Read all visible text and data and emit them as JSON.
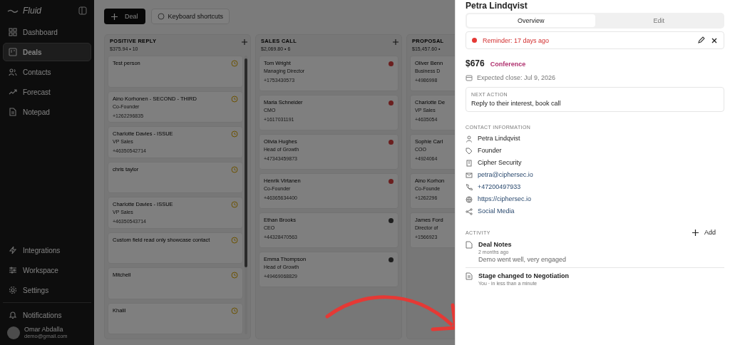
{
  "sidebar": {
    "logo": "Fluid",
    "nav": [
      {
        "label": "Dashboard",
        "selected": false
      },
      {
        "label": "Deals",
        "selected": true
      },
      {
        "label": "Contacts",
        "selected": false
      },
      {
        "label": "Forecast",
        "selected": false
      },
      {
        "label": "Notepad",
        "selected": false
      }
    ],
    "bottom_nav": [
      {
        "label": "Integrations"
      },
      {
        "label": "Workspace"
      },
      {
        "label": "Settings"
      }
    ],
    "notifications": "Notifications",
    "user": {
      "name": "Omar Abdalla",
      "email": "demo@gmail.com"
    }
  },
  "toolbar": {
    "new_button": "Deal",
    "shortcuts_button": "Keyboard shortcuts"
  },
  "columns": [
    {
      "title": "POSITIVE REPLY",
      "summary": "$375.94 • 10",
      "add": true,
      "scrollable": true,
      "cards": [
        {
          "kind": "task",
          "name": "Test person"
        },
        {
          "kind": "task",
          "name": "Aino Korhonen - SECOND - THIRD",
          "role": "Co-Founder",
          "phone": "+1262296835"
        },
        {
          "kind": "task",
          "name": "Charlotte Davies - ISSUE",
          "role": "VP Sales",
          "phone": "+46350542714"
        },
        {
          "kind": "task",
          "name": "chris taylor"
        },
        {
          "kind": "task",
          "name": "Charlotte Davies - ISSUE",
          "role": "VP Sales",
          "phone": "+46350543714"
        },
        {
          "kind": "task",
          "name": "Custom field read only showcase contact"
        },
        {
          "kind": "task",
          "name": "Mitchell"
        },
        {
          "kind": "task",
          "name": "Khalil"
        }
      ]
    },
    {
      "title": "SALES CALL",
      "summary": "$2,069.80 • 6",
      "add": true,
      "scrollable": false,
      "cards": [
        {
          "kind": "status",
          "name": "Tom Wright",
          "role": "Managing Director",
          "phone": "+1753430573",
          "color": "#6b1f1f"
        },
        {
          "kind": "status",
          "name": "Maria Schneider",
          "role": "CMO",
          "phone": "+1617031191",
          "color": "#6b1f1f"
        },
        {
          "kind": "status",
          "name": "Olivia Hughes",
          "role": "Head of Growth",
          "phone": "+47343459873",
          "color": "#6b1f1f"
        },
        {
          "kind": "status",
          "name": "Henrik Virtanen",
          "role": "Co-Founder",
          "phone": "+46365634400",
          "color": "#6b1f1f"
        },
        {
          "kind": "status",
          "name": "Ethan Brooks",
          "role": "CEO",
          "phone": "+44328470563",
          "color": "#1e1e1e"
        },
        {
          "kind": "status",
          "name": "Emma Thompson",
          "role": "Head of Growth",
          "phone": "+49469068829",
          "color": "#1e1e1e"
        }
      ]
    },
    {
      "title": "PROPOSAL",
      "summary": "$15,457.60 •",
      "add": false,
      "scrollable": false,
      "cards": [
        {
          "kind": "plain",
          "name": "Oliver Benn",
          "role": "Business D",
          "phone": "+4986998"
        },
        {
          "kind": "plain",
          "name": "Charlotte De",
          "role": "VP Sales",
          "phone": "+4635054"
        },
        {
          "kind": "plain",
          "name": "Sophie Carl",
          "role": "COO",
          "phone": "+4924064"
        },
        {
          "kind": "plain",
          "name": "Aino Korhon",
          "role": "Co-Founde",
          "phone": "+1262296"
        },
        {
          "kind": "plain",
          "name": "James Ford",
          "role": "Director of",
          "phone": "+1566923"
        }
      ]
    }
  ],
  "drawer": {
    "title": "Petra Lindqvist",
    "tabs": [
      {
        "label": "Overview",
        "selected": true
      },
      {
        "label": "Edit",
        "selected": false
      }
    ],
    "reminder": "Reminder: 17 days ago",
    "amount": "$676",
    "source": "Conference",
    "expected_close": "Expected close: Jul 9, 2026",
    "next_action": {
      "label": "NEXT ACTION",
      "text": "Reply to their interest, book call"
    },
    "contact_heading": "CONTACT INFORMATION",
    "contact": [
      {
        "kind": "person",
        "text": "Petra Lindqvist",
        "link": false
      },
      {
        "kind": "tag",
        "text": "Founder",
        "link": false
      },
      {
        "kind": "company",
        "text": "Cipher Security",
        "link": false
      },
      {
        "kind": "email",
        "text": "petra@ciphersec.io",
        "link": true
      },
      {
        "kind": "phone",
        "text": "+47200497933",
        "link": true
      },
      {
        "kind": "web",
        "text": "https://ciphersec.io",
        "link": true
      },
      {
        "kind": "social",
        "text": "Social Media",
        "link": true
      }
    ],
    "activity_heading": "ACTIVITY",
    "add_button": "Add",
    "activity": [
      {
        "kind": "note",
        "title": "Deal Notes",
        "meta": "2 months ago",
        "body": "Demo went well, very engaged"
      },
      {
        "kind": "stage",
        "title": "Stage changed to Negotiation",
        "meta": "You · in less than a minute"
      }
    ]
  }
}
